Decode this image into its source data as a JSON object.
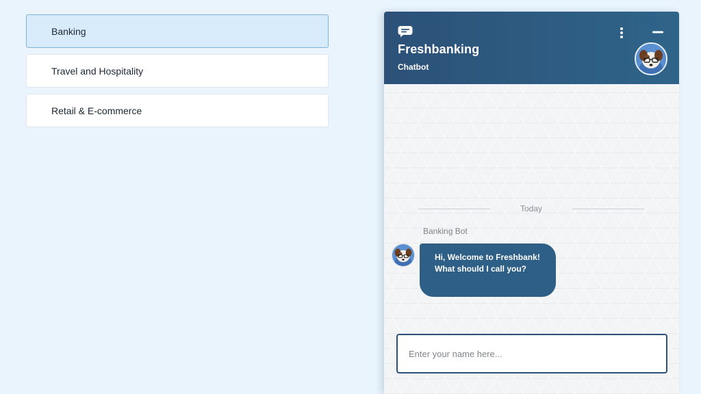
{
  "industries": [
    {
      "label": "Banking",
      "active": true
    },
    {
      "label": "Travel and Hospitality",
      "active": false
    },
    {
      "label": "Retail & E-commerce",
      "active": false
    }
  ],
  "chat": {
    "title": "Freshbanking",
    "subtitle": "Chatbot",
    "header_icons": {
      "logo": "chat-bubble-icon",
      "menu": "more-vertical-icon",
      "minimize": "minimize-icon"
    },
    "day_divider": "Today",
    "sender": "Banking Bot",
    "message_lines": [
      "Hi, Welcome to Freshbank!",
      "What should I call you?"
    ],
    "input_placeholder": "Enter your name here..."
  },
  "colors": {
    "page_background": "#eaf4fd",
    "header": "#2c5178",
    "bubble": "#2e5f87",
    "active_item": "#d8ebfa"
  }
}
